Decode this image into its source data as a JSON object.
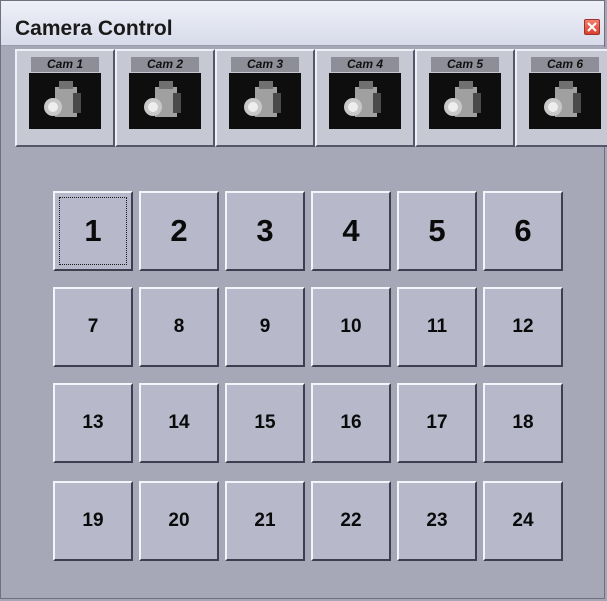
{
  "window": {
    "title": "Camera Control",
    "close_icon": "close-icon"
  },
  "cameras": [
    {
      "label": "Cam 1",
      "icon": "camera-icon"
    },
    {
      "label": "Cam 2",
      "icon": "camera-icon"
    },
    {
      "label": "Cam 3",
      "icon": "camera-icon"
    },
    {
      "label": "Cam 4",
      "icon": "camera-icon"
    },
    {
      "label": "Cam 5",
      "icon": "camera-icon"
    },
    {
      "label": "Cam 6",
      "icon": "camera-icon"
    }
  ],
  "keypad": {
    "keys": [
      "1",
      "2",
      "3",
      "4",
      "5",
      "6",
      "7",
      "8",
      "9",
      "10",
      "11",
      "12",
      "13",
      "14",
      "15",
      "16",
      "17",
      "18",
      "19",
      "20",
      "21",
      "22",
      "23",
      "24"
    ],
    "focused": "1"
  },
  "colors": {
    "background": "#a6a7b7",
    "button_face": "#b7b9cb",
    "close_button": "#d94030"
  }
}
